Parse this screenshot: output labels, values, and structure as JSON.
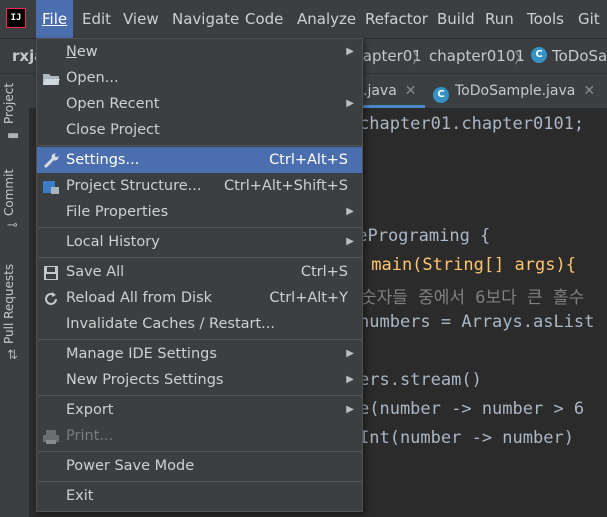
{
  "menubar": {
    "logo": "IJ",
    "items": [
      "File",
      "Edit",
      "View",
      "Navigate",
      "Code",
      "Analyze",
      "Refactor",
      "Build",
      "Run",
      "Tools",
      "Git"
    ]
  },
  "navbar": {
    "project": "rxja",
    "crumbs": [
      "chapter01",
      "chapter0101",
      "ToDoSa"
    ]
  },
  "toolstrip": {
    "labels": [
      "Project",
      "Commit",
      "Pull Requests"
    ]
  },
  "tabs": [
    {
      "label": ".java",
      "close": "✕"
    },
    {
      "label": "ToDoSample.java",
      "close": "✕"
    }
  ],
  "code": {
    "lines": [
      "chapter01.chapter0101;",
      "vePrograming {",
      " main(String[] args){",
      "숫자들 중에서 6보다 큰 홀수",
      "numbers = Arrays.asList",
      "ers.stream()",
      "e(number -> number > 6",
      "Int(number -> number)"
    ]
  },
  "file_menu": {
    "items": [
      {
        "label": "New",
        "shortcut": "",
        "submenu": true
      },
      {
        "label": "Open...",
        "shortcut": "",
        "submenu": false
      },
      {
        "label": "Open Recent",
        "shortcut": "",
        "submenu": true
      },
      {
        "label": "Close Project",
        "shortcut": "",
        "submenu": false
      },
      {
        "label": "Settings...",
        "shortcut": "Ctrl+Alt+S",
        "submenu": false
      },
      {
        "label": "Project Structure...",
        "shortcut": "Ctrl+Alt+Shift+S",
        "submenu": false
      },
      {
        "label": "File Properties",
        "shortcut": "",
        "submenu": true
      },
      {
        "label": "Local History",
        "shortcut": "",
        "submenu": true
      },
      {
        "label": "Save All",
        "shortcut": "Ctrl+S",
        "submenu": false
      },
      {
        "label": "Reload All from Disk",
        "shortcut": "Ctrl+Alt+Y",
        "submenu": false
      },
      {
        "label": "Invalidate Caches / Restart...",
        "shortcut": "",
        "submenu": false
      },
      {
        "label": "Manage IDE Settings",
        "shortcut": "",
        "submenu": true
      },
      {
        "label": "New Projects Settings",
        "shortcut": "",
        "submenu": true
      },
      {
        "label": "Export",
        "shortcut": "",
        "submenu": true
      },
      {
        "label": "Print...",
        "shortcut": "",
        "submenu": false
      },
      {
        "label": "Power Save Mode",
        "shortcut": "",
        "submenu": false
      },
      {
        "label": "Exit",
        "shortcut": "",
        "submenu": false
      }
    ],
    "highlighted": "Settings...",
    "disabled": [
      "Print..."
    ]
  },
  "colors": {
    "accent": "#4b6eaf",
    "menu_bg": "#3c3f41",
    "editor_bg": "#2b2b2b"
  }
}
